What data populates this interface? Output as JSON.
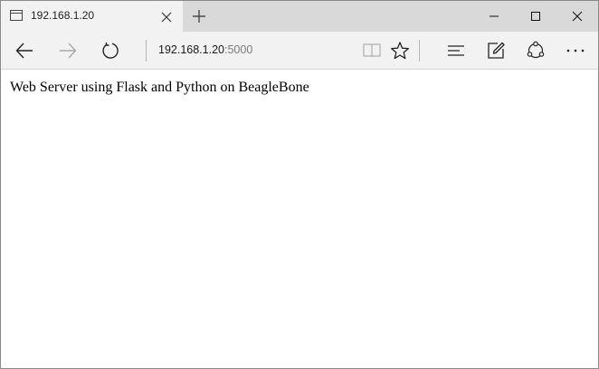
{
  "tab": {
    "title": "192.168.1.20",
    "page_icon": "page-icon",
    "close_icon": "close-icon"
  },
  "new_tab_icon": "plus-icon",
  "window_controls": [
    "minimize-icon",
    "maximize-icon",
    "close-icon"
  ],
  "navigation": {
    "back_icon": "arrow-left-icon",
    "forward_icon": "arrow-right-icon",
    "refresh_icon": "refresh-icon",
    "address": {
      "host": "192.168.1.20",
      "port": ":5000"
    },
    "toolbar_icons": [
      "book-icon",
      "star-icon",
      "hub-icon",
      "note-icon",
      "share-icon",
      "more-icon"
    ]
  },
  "page": {
    "text": "Web Server using Flask and Python on BeagleBone"
  },
  "colors": {
    "tab_strip": "#d9d9d9",
    "active_tab": "#f2f2f2",
    "toolbar": "#f2f2f2",
    "port_text": "#7a7a7a"
  }
}
